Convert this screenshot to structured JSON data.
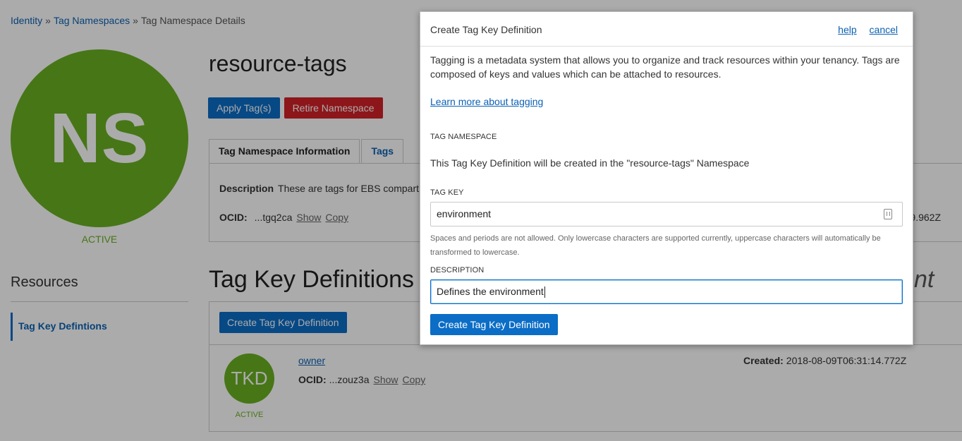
{
  "breadcrumb": {
    "items": [
      "Identity",
      "Tag Namespaces"
    ],
    "current": "Tag Namespace Details",
    "separator": "»"
  },
  "namespace": {
    "avatar_text": "NS",
    "state": "ACTIVE",
    "name": "resource-tags",
    "apply_button": "Apply Tag(s)",
    "retire_button": "Retire Namespace",
    "tabs": [
      "Tag Namespace Information",
      "Tags"
    ],
    "description_label": "Description",
    "description_value": "These are tags for EBS compart",
    "ocid_label": "OCID:",
    "ocid_value": "...tgq2ca",
    "show_link": "Show",
    "copy_link": "Copy",
    "created_partial": "9.962Z"
  },
  "resources": {
    "title": "Resources",
    "items": [
      "Tag Key Defintions"
    ]
  },
  "tag_keys": {
    "title": "Tag Key Definitions",
    "title_tail": "nt",
    "create_button": "Create Tag Key Definition",
    "rows": [
      {
        "avatar_text": "TKD",
        "state": "ACTIVE",
        "name": "owner",
        "ocid_label": "OCID:",
        "ocid_value": "...zouz3a",
        "show_link": "Show",
        "copy_link": "Copy",
        "created_label": "Created:",
        "created_value": "2018-08-09T06:31:14.772Z"
      }
    ]
  },
  "modal": {
    "title": "Create Tag Key Definition",
    "help_link": "help",
    "cancel_link": "cancel",
    "intro": "Tagging is a metadata system that allows you to organize and track resources within your tenancy. Tags are composed of keys and values which can be attached to resources.",
    "learn_more": "Learn more about tagging",
    "namespace_label": "TAG NAMESPACE",
    "namespace_text": "This Tag Key Definition will be created in the \"resource-tags\" Namespace",
    "tag_key_label": "TAG KEY",
    "tag_key_value": "environment",
    "tag_key_icon": "contact-card-icon",
    "tag_key_hint": "Spaces and periods are not allowed. Only lowercase characters are supported currently, uppercase characters will automatically be transformed to lowercase.",
    "description_label": "DESCRIPTION",
    "description_value": "Defines the environment",
    "submit_button": "Create Tag Key Definition"
  },
  "colors": {
    "primary_blue": "#0b6dc6",
    "danger_red": "#d22228",
    "active_green": "#6ab023",
    "link_blue": "#0b61b3"
  }
}
